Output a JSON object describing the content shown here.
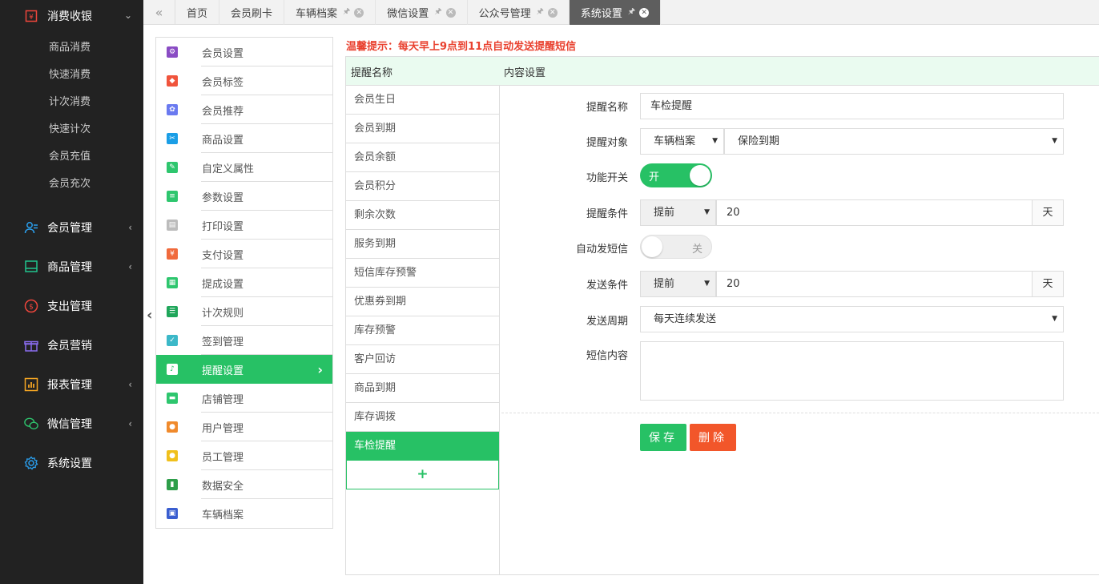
{
  "leftnav": {
    "top": {
      "label": "消费收银",
      "icon": "cashier-icon",
      "arrow": "⌄"
    },
    "sub_items": [
      "商品消费",
      "快速消费",
      "计次消费",
      "快速计次",
      "会员充值",
      "会员充次"
    ],
    "groups": [
      {
        "label": "会员管理",
        "icon": "member-icon",
        "color": "#2aa0f0",
        "arrow": "‹"
      },
      {
        "label": "商品管理",
        "icon": "goods-icon",
        "color": "#21c48e",
        "arrow": "‹"
      },
      {
        "label": "支出管理",
        "icon": "expense-icon",
        "color": "#f0463c",
        "arrow": ""
      },
      {
        "label": "会员营销",
        "icon": "gift-icon",
        "color": "#8a6cf0",
        "arrow": ""
      },
      {
        "label": "报表管理",
        "icon": "report-icon",
        "color": "#f5a623",
        "arrow": "‹"
      },
      {
        "label": "微信管理",
        "icon": "wechat-icon",
        "color": "#2ec66e",
        "arrow": "‹"
      },
      {
        "label": "系统设置",
        "icon": "gear-icon",
        "color": "#2aa0f0",
        "arrow": ""
      }
    ]
  },
  "tabs": {
    "prev_icon": "«",
    "pin_icon": "🖈",
    "close_icon": "✕",
    "items": [
      {
        "label": "首页",
        "closable": false,
        "active": false
      },
      {
        "label": "会员刷卡",
        "closable": false,
        "active": false
      },
      {
        "label": "车辆档案",
        "closable": true,
        "active": false
      },
      {
        "label": "微信设置",
        "closable": true,
        "active": false
      },
      {
        "label": "公众号管理",
        "closable": true,
        "active": false
      },
      {
        "label": "系统设置",
        "closable": true,
        "active": true
      }
    ]
  },
  "collapse_icon": "‹",
  "settings_menu": {
    "items": [
      {
        "label": "会员设置",
        "color": "#8a4cc4",
        "glyph": "⚙"
      },
      {
        "label": "会员标签",
        "color": "#f0543c",
        "glyph": "◆"
      },
      {
        "label": "会员推荐",
        "color": "#6a7af0",
        "glyph": "✿"
      },
      {
        "label": "商品设置",
        "color": "#1a9ee6",
        "glyph": "✂"
      },
      {
        "label": "自定义属性",
        "color": "#2ec66e",
        "glyph": "✎"
      },
      {
        "label": "参数设置",
        "color": "#2ec66e",
        "glyph": "≡"
      },
      {
        "label": "打印设置",
        "color": "#bcbcbc",
        "glyph": "▤"
      },
      {
        "label": "支付设置",
        "color": "#f06a3c",
        "glyph": "¥"
      },
      {
        "label": "提成设置",
        "color": "#2ec66e",
        "glyph": "▦"
      },
      {
        "label": "计次规则",
        "color": "#1fa65a",
        "glyph": "☰"
      },
      {
        "label": "签到管理",
        "color": "#3cb8c8",
        "glyph": "✓"
      },
      {
        "label": "提醒设置",
        "color": "#27c165",
        "glyph": "♪"
      },
      {
        "label": "店铺管理",
        "color": "#2ec66e",
        "glyph": "▬"
      },
      {
        "label": "用户管理",
        "color": "#f08a2c",
        "glyph": "●"
      },
      {
        "label": "员工管理",
        "color": "#f0c01c",
        "glyph": "●"
      },
      {
        "label": "数据安全",
        "color": "#2e9e4a",
        "glyph": "▮"
      },
      {
        "label": "车辆档案",
        "color": "#3a5ed0",
        "glyph": "▣"
      }
    ],
    "active_index": 11,
    "active_arrow": "›"
  },
  "tip": "温馨提示：每天早上9点到11点自动发送提醒短信",
  "reminder_panel": {
    "header_name": "提醒名称",
    "header_content": "内容设置",
    "items": [
      "会员生日",
      "会员到期",
      "会员余额",
      "会员积分",
      "剩余次数",
      "服务到期",
      "短信库存预警",
      "优惠券到期",
      "库存预警",
      "客户回访",
      "商品到期",
      "库存调拨",
      "车检提醒"
    ],
    "active_index": 12,
    "add_label": "+"
  },
  "form": {
    "name_label": "提醒名称",
    "name_value": "车检提醒",
    "target_label": "提醒对象",
    "target_type": "车辆档案",
    "target_field": "保险到期",
    "switch_label": "功能开关",
    "switch_text": "开",
    "condition_label": "提醒条件",
    "condition_mode": "提前",
    "condition_value": "20",
    "condition_unit": "天",
    "auto_sms_label": "自动发短信",
    "auto_sms_text": "关",
    "send_condition_label": "发送条件",
    "send_condition_mode": "提前",
    "send_condition_value": "20",
    "send_condition_unit": "天",
    "cycle_label": "发送周期",
    "cycle_value": "每天连续发送",
    "sms_content_label": "短信内容",
    "sms_content_value": "",
    "caret": "▼",
    "save_label": "保存",
    "delete_label": "删除"
  }
}
